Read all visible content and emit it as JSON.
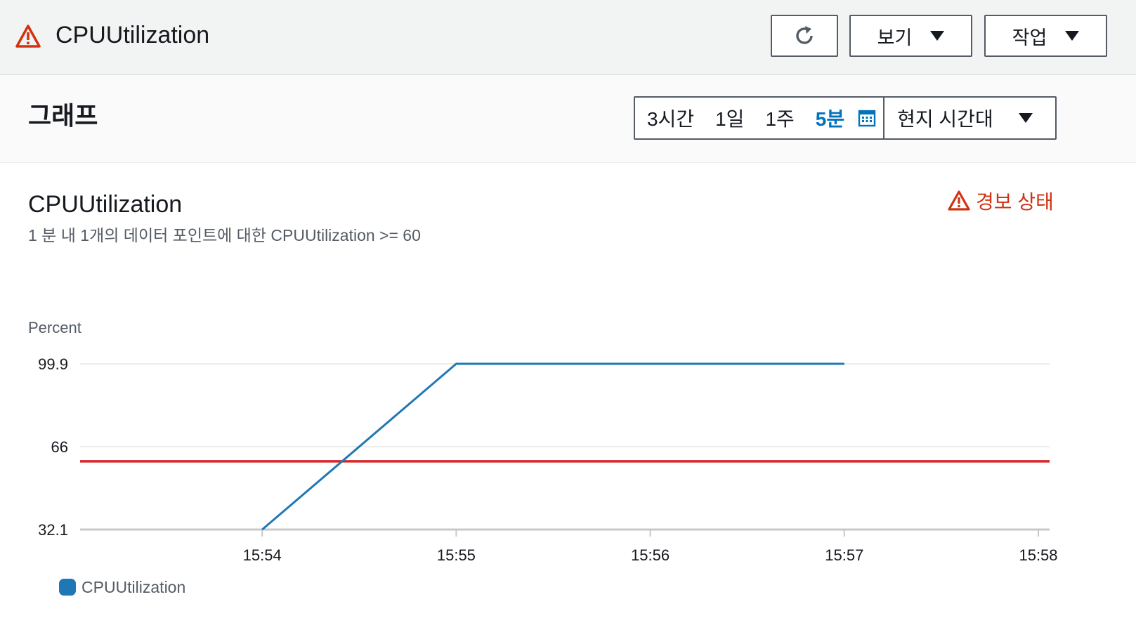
{
  "header": {
    "title": "CPUUtilization",
    "status_icon": "warning-triangle-icon",
    "refresh_icon": "refresh-icon",
    "view_label": "보기",
    "action_label": "작업"
  },
  "panel": {
    "title": "그래프",
    "time_range": {
      "options": [
        "3시간",
        "1일",
        "1주",
        "5분"
      ],
      "selected": "5분",
      "calendar_icon": "calendar-icon",
      "timezone": "현지 시간대"
    }
  },
  "chart": {
    "title": "CPUUtilization",
    "subtitle": "1 분 내 1개의 데이터 포인트에 대한 CPUUtilization >= 60",
    "status_label": "경보 상태",
    "status_color": "#d13212",
    "line_color": "#1f77b4",
    "threshold_color": "#d62728"
  },
  "chart_data": {
    "type": "line",
    "ylabel": "Percent",
    "xlabel": "",
    "x_ticks": [
      "15:54",
      "15:55",
      "15:56",
      "15:57",
      "15:58"
    ],
    "y_ticks": [
      32.1,
      66,
      99.9
    ],
    "ylim": [
      32.1,
      99.9
    ],
    "xlim": [
      "15:53",
      "15:58"
    ],
    "series": [
      {
        "name": "CPUUtilization",
        "x": [
          "15:54",
          "15:55",
          "15:56",
          "15:57"
        ],
        "y": [
          32.1,
          99.9,
          99.9,
          99.9
        ]
      }
    ],
    "threshold": 60,
    "grid": true,
    "legend": "bottom-left"
  }
}
